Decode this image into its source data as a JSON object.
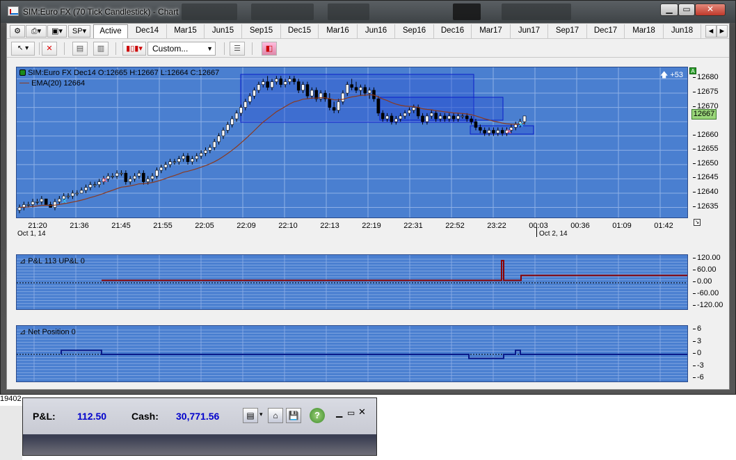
{
  "window": {
    "title": "SIM:Euro FX (70 Tick Candlestick) - Chart"
  },
  "toolbar": {
    "instrument_button": "SP",
    "tabs": [
      "Active",
      "Dec14",
      "Mar15",
      "Jun15",
      "Sep15",
      "Dec15",
      "Mar16",
      "Jun16",
      "Sep16",
      "Dec16",
      "Mar17",
      "Jun17",
      "Sep17",
      "Dec17",
      "Mar18",
      "Jun18"
    ],
    "active_tab": "Active",
    "scroll_left": "◄",
    "scroll_right": "►",
    "chart_style_dropdown": "Custom..."
  },
  "price_panel": {
    "header": "SIM:Euro FX Dec14 O:12665 H:12667 L:12664 C:12667",
    "ema_label": "EMA(20)  12664",
    "offset_badge": "+53",
    "current_price": "12667",
    "y_ticks": [
      "12680",
      "12675",
      "12670",
      "12665",
      "12660",
      "12655",
      "12650",
      "12645",
      "12640",
      "12635"
    ],
    "x_ticks": [
      "21:20",
      "21:36",
      "21:45",
      "21:55",
      "22:05",
      "22:09",
      "22:10",
      "22:13",
      "22:19",
      "22:31",
      "22:52",
      "23:22",
      "00:03",
      "00:36",
      "01:09",
      "01:42"
    ],
    "date_start": "Oct 1, 14",
    "date_end": "Oct 2, 14"
  },
  "pnl_panel": {
    "label": "P&L  113  UP&L  0",
    "y_ticks": [
      "120.00",
      "60.00",
      "0.00",
      "-60.00",
      "-120.00"
    ]
  },
  "position_panel": {
    "label": "Net Position  0",
    "y_ticks": [
      "6",
      "3",
      "0",
      "-3",
      "-6"
    ]
  },
  "status_strip": {
    "pnl_label": "P&L:",
    "pnl_value": "112.50",
    "cash_label": "Cash:",
    "cash_value": "30,771.56",
    "side_fragment": "19402"
  },
  "colors": {
    "chart_bg": "#4a7fd0",
    "ema_line": "#8b3a1f",
    "pnl_line": "#8b0000",
    "position_line": "#0a1a8a",
    "value_blue": "#0000cc"
  },
  "candles": [
    [
      12634,
      12636,
      12633,
      12635
    ],
    [
      12635,
      12637,
      12634,
      12636
    ],
    [
      12636,
      12637,
      12635,
      12636
    ],
    [
      12636,
      12638,
      12635,
      12637
    ],
    [
      12637,
      12638,
      12636,
      12637
    ],
    [
      12637,
      12639,
      12636,
      12638
    ],
    [
      12638,
      12638,
      12636,
      12636
    ],
    [
      12636,
      12637,
      12635,
      12635
    ],
    [
      12635,
      12638,
      12634,
      12637
    ],
    [
      12637,
      12639,
      12636,
      12638
    ],
    [
      12638,
      12640,
      12637,
      12639
    ],
    [
      12639,
      12640,
      12638,
      12639
    ],
    [
      12639,
      12641,
      12638,
      12640
    ],
    [
      12640,
      12641,
      12639,
      12640
    ],
    [
      12640,
      12642,
      12640,
      12641
    ],
    [
      12641,
      12643,
      12640,
      12642
    ],
    [
      12642,
      12644,
      12641,
      12643
    ],
    [
      12643,
      12644,
      12642,
      12643
    ],
    [
      12643,
      12645,
      12642,
      12644
    ],
    [
      12644,
      12646,
      12643,
      12645
    ],
    [
      12645,
      12647,
      12644,
      12646
    ],
    [
      12646,
      12647,
      12645,
      12646
    ],
    [
      12646,
      12648,
      12645,
      12647
    ],
    [
      12647,
      12648,
      12646,
      12647
    ],
    [
      12647,
      12648,
      12643,
      12644
    ],
    [
      12644,
      12646,
      12643,
      12645
    ],
    [
      12645,
      12647,
      12644,
      12646
    ],
    [
      12646,
      12648,
      12645,
      12647
    ],
    [
      12647,
      12648,
      12643,
      12644
    ],
    [
      12644,
      12646,
      12643,
      12645
    ],
    [
      12645,
      12647,
      12644,
      12646
    ],
    [
      12646,
      12649,
      12645,
      12648
    ],
    [
      12648,
      12650,
      12647,
      12649
    ],
    [
      12649,
      12651,
      12648,
      12650
    ],
    [
      12650,
      12652,
      12649,
      12651
    ],
    [
      12651,
      12652,
      12650,
      12651
    ],
    [
      12651,
      12653,
      12650,
      12652
    ],
    [
      12652,
      12654,
      12651,
      12653
    ],
    [
      12653,
      12654,
      12650,
      12651
    ],
    [
      12651,
      12653,
      12650,
      12652
    ],
    [
      12652,
      12654,
      12651,
      12653
    ],
    [
      12653,
      12655,
      12652,
      12654
    ],
    [
      12654,
      12656,
      12653,
      12655
    ],
    [
      12655,
      12657,
      12654,
      12656
    ],
    [
      12656,
      12659,
      12655,
      12658
    ],
    [
      12658,
      12661,
      12657,
      12660
    ],
    [
      12660,
      12663,
      12659,
      12662
    ],
    [
      12662,
      12665,
      12661,
      12664
    ],
    [
      12664,
      12667,
      12663,
      12666
    ],
    [
      12666,
      12669,
      12665,
      12668
    ],
    [
      12668,
      12671,
      12667,
      12670
    ],
    [
      12670,
      12673,
      12669,
      12672
    ],
    [
      12672,
      12675,
      12671,
      12674
    ],
    [
      12674,
      12677,
      12673,
      12676
    ],
    [
      12676,
      12679,
      12675,
      12678
    ],
    [
      12678,
      12680,
      12677,
      12679
    ],
    [
      12679,
      12681,
      12676,
      12677
    ],
    [
      12677,
      12680,
      12676,
      12679
    ],
    [
      12679,
      12681,
      12678,
      12680
    ],
    [
      12680,
      12681,
      12677,
      12678
    ],
    [
      12678,
      12680,
      12677,
      12679
    ],
    [
      12679,
      12681,
      12678,
      12680
    ],
    [
      12680,
      12681,
      12678,
      12679
    ],
    [
      12679,
      12680,
      12675,
      12676
    ],
    [
      12676,
      12679,
      12675,
      12678
    ],
    [
      12678,
      12679,
      12673,
      12674
    ],
    [
      12674,
      12677,
      12673,
      12676
    ],
    [
      12676,
      12677,
      12672,
      12673
    ],
    [
      12673,
      12676,
      12672,
      12675
    ],
    [
      12675,
      12676,
      12672,
      12673
    ],
    [
      12673,
      12675,
      12669,
      12670
    ],
    [
      12670,
      12672,
      12668,
      12669
    ],
    [
      12669,
      12673,
      12668,
      12672
    ],
    [
      12672,
      12676,
      12671,
      12675
    ],
    [
      12675,
      12679,
      12674,
      12678
    ],
    [
      12678,
      12680,
      12676,
      12677
    ],
    [
      12677,
      12679,
      12675,
      12676
    ],
    [
      12676,
      12678,
      12674,
      12677
    ],
    [
      12677,
      12678,
      12674,
      12675
    ],
    [
      12675,
      12677,
      12673,
      12676
    ],
    [
      12676,
      12677,
      12672,
      12673
    ],
    [
      12673,
      12674,
      12667,
      12668
    ],
    [
      12668,
      12669,
      12665,
      12666
    ],
    [
      12666,
      12668,
      12665,
      12667
    ],
    [
      12667,
      12668,
      12664,
      12665
    ],
    [
      12665,
      12667,
      12664,
      12666
    ],
    [
      12666,
      12668,
      12665,
      12667
    ],
    [
      12667,
      12669,
      12666,
      12668
    ],
    [
      12668,
      12670,
      12667,
      12669
    ],
    [
      12669,
      12671,
      12668,
      12670
    ],
    [
      12670,
      12671,
      12666,
      12667
    ],
    [
      12667,
      12668,
      12664,
      12665
    ],
    [
      12665,
      12668,
      12664,
      12667
    ],
    [
      12667,
      12669,
      12666,
      12668
    ],
    [
      12668,
      12669,
      12665,
      12666
    ],
    [
      12666,
      12668,
      12665,
      12667
    ],
    [
      12667,
      12668,
      12665,
      12666
    ],
    [
      12666,
      12668,
      12665,
      12667
    ],
    [
      12667,
      12668,
      12665,
      12666
    ],
    [
      12666,
      12668,
      12665,
      12667
    ],
    [
      12667,
      12668,
      12666,
      12667
    ],
    [
      12667,
      12668,
      12665,
      12666
    ],
    [
      12666,
      12667,
      12664,
      12665
    ],
    [
      12665,
      12666,
      12662,
      12663
    ],
    [
      12663,
      12664,
      12661,
      12662
    ],
    [
      12662,
      12663,
      12660,
      12661
    ],
    [
      12661,
      12663,
      12660,
      12662
    ],
    [
      12662,
      12663,
      12660,
      12661
    ],
    [
      12661,
      12663,
      12660,
      12662
    ],
    [
      12662,
      12663,
      12660,
      12661
    ],
    [
      12661,
      12663,
      12660,
      12662
    ],
    [
      12662,
      12664,
      12661,
      12663
    ],
    [
      12663,
      12665,
      12662,
      12664
    ],
    [
      12664,
      12666,
      12663,
      12665
    ],
    [
      12665,
      12667,
      12664,
      12667
    ]
  ]
}
